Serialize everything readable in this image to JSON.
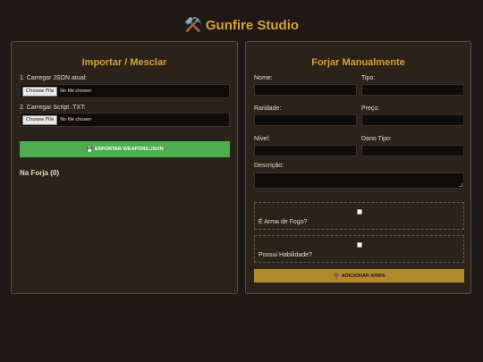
{
  "app": {
    "title": "Gunfire Studio",
    "logo_icon": "⚒️"
  },
  "import_panel": {
    "title": "Importar / Mesclar",
    "json_label": "1. Carregar JSON atual:",
    "txt_label": "2. Carregar Script .TXT:",
    "file_button": "Choose File",
    "file_status": "No file chosen",
    "export_icon": "💾",
    "export_label": "EXPORTAR WEAPONS.JSON",
    "forge_heading": "Na Forja (0)"
  },
  "forge_panel": {
    "title": "Forjar Manualmente",
    "fields": {
      "nome": "Nome:",
      "tipo": "Tipo:",
      "raridade": "Raridade:",
      "preco": "Preço:",
      "nivel": "Nível:",
      "dano_tipo": "Dano Tipo:",
      "descricao": "Descrição:"
    },
    "checkbox_firearm": "É Arma de Fogo?",
    "checkbox_ability": "Possui Habilidade?",
    "add_icon": "➕",
    "add_label": "ADICIONAR ARMA"
  },
  "colors": {
    "background": "#1e1914",
    "panel": "#2b221a",
    "accent": "#d4a23a",
    "export_button": "#4caf50",
    "add_button": "#b3892e"
  }
}
